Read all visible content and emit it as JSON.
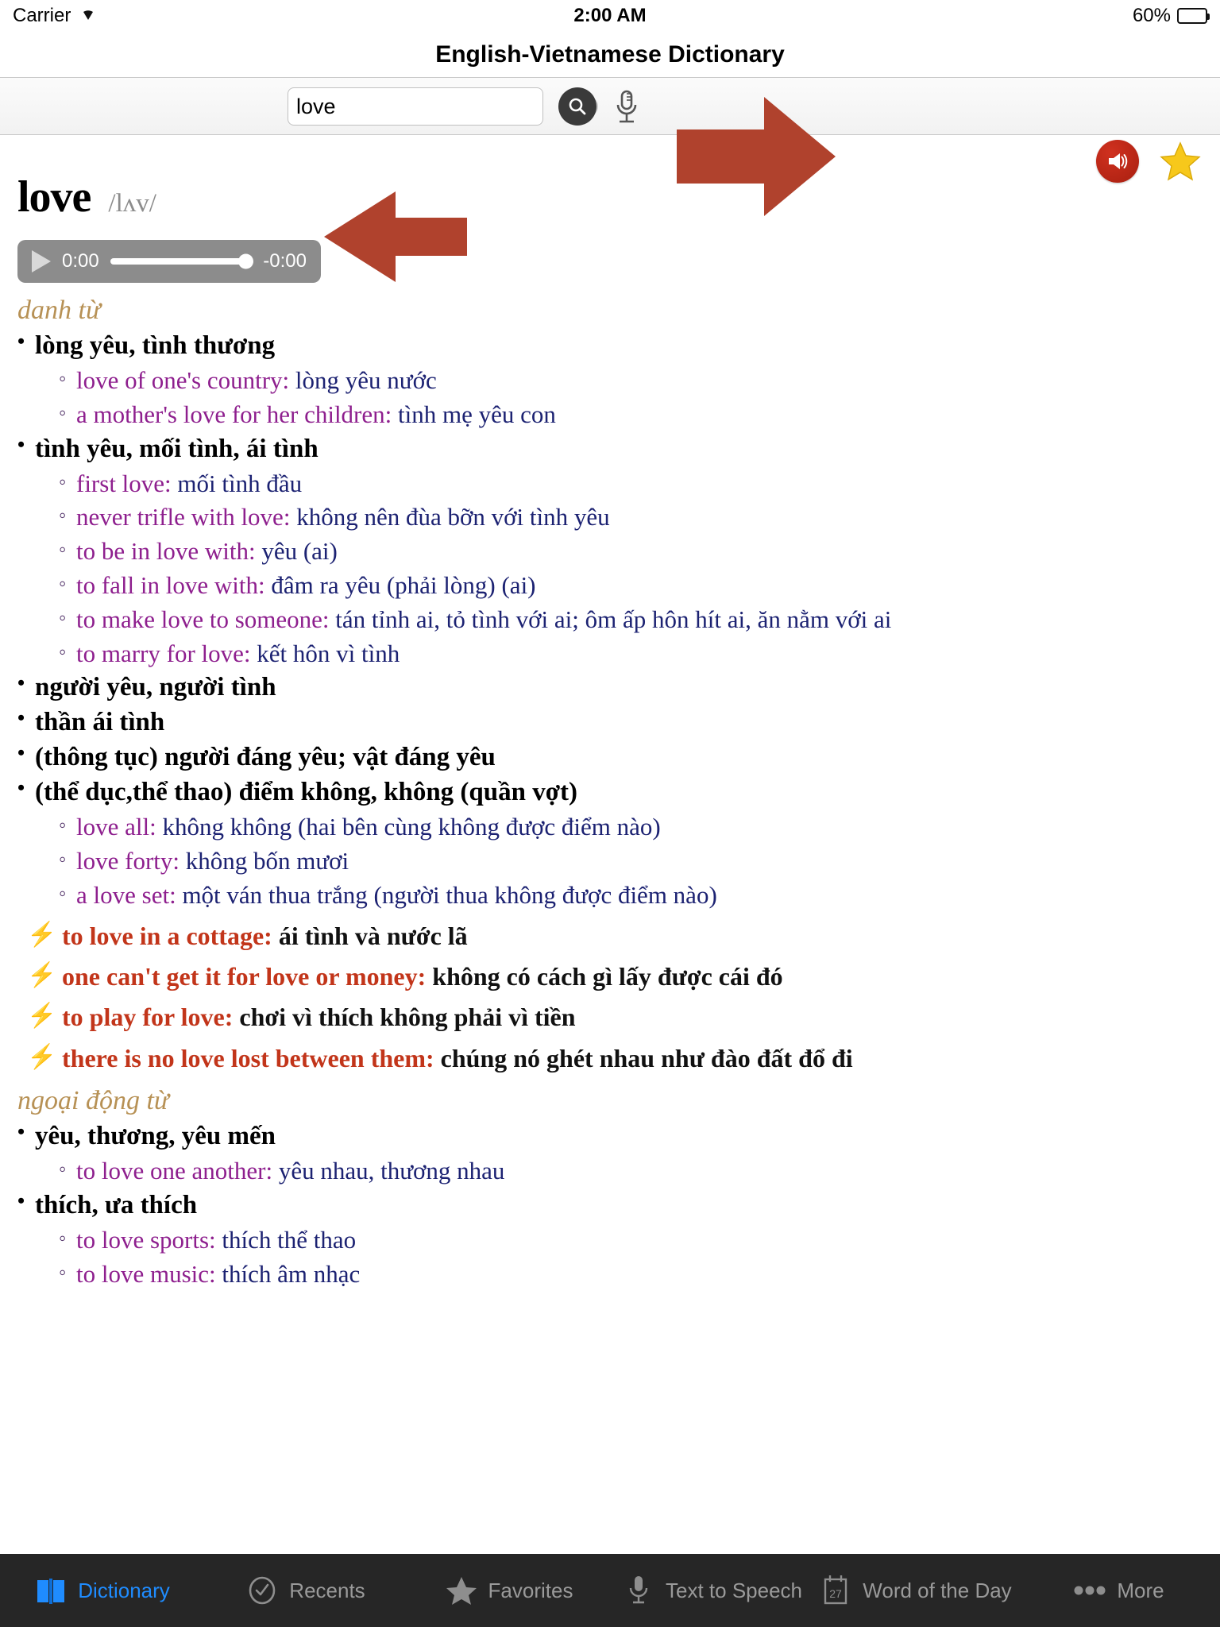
{
  "status_bar": {
    "carrier": "Carrier",
    "wifi_icon": "wifi-icon",
    "time": "2:00 AM",
    "battery_percent": "60%",
    "battery_icon": "battery-icon"
  },
  "nav": {
    "title": "English-Vietnamese Dictionary"
  },
  "search": {
    "value": "love",
    "placeholder": "",
    "clear_icon": "clear-icon",
    "search_icon": "search-icon",
    "mic_icon": "microphone-icon"
  },
  "actions": {
    "speaker_icon": "speaker-icon",
    "star_icon": "star-icon"
  },
  "entry": {
    "headword": "love",
    "phonetic": "/lʌv/",
    "audio": {
      "play_icon": "play-icon",
      "elapsed": "0:00",
      "remaining": "-0:00",
      "progress_percent": 100
    },
    "sections": [
      {
        "pos": "danh từ",
        "blocks": [
          {
            "type": "sense",
            "text": "lòng yêu, tình thương",
            "examples": [
              {
                "en": "love of one's country:",
                "vi": " lòng yêu nước"
              },
              {
                "en": "a mother's love for her children:",
                "vi": " tình mẹ yêu con"
              }
            ]
          },
          {
            "type": "sense",
            "text": "tình yêu, mối tình, ái tình",
            "examples": [
              {
                "en": "first love:",
                "vi": " mối tình đầu"
              },
              {
                "en": "never trifle with love:",
                "vi": " không nên đùa bỡn với tình yêu"
              },
              {
                "en": "to be in love with:",
                "vi": " yêu (ai)"
              },
              {
                "en": "to fall in love with:",
                "vi": " đâm ra yêu (phải lòng) (ai)"
              },
              {
                "en": "to make love to someone:",
                "vi": " tán tỉnh ai, tỏ tình với ai; ôm ấp hôn hít ai, ăn nằm với ai"
              },
              {
                "en": "to marry for love:",
                "vi": " kết hôn vì tình"
              }
            ]
          },
          {
            "type": "sense",
            "text": "người yêu, người tình",
            "examples": []
          },
          {
            "type": "sense",
            "text": "thần ái tình",
            "examples": []
          },
          {
            "type": "sense",
            "text": "(thông tục) người đáng yêu; vật đáng yêu",
            "examples": []
          },
          {
            "type": "sense",
            "text": "(thể dục,thể thao) điểm không, không (quần vợt)",
            "examples": [
              {
                "en": "love all:",
                "vi": " không không (hai bên cùng không được điểm nào)"
              },
              {
                "en": "love forty:",
                "vi": " không bốn mươi"
              },
              {
                "en": "a love set:",
                "vi": " một ván thua trắng (người thua không được điểm nào)"
              }
            ]
          },
          {
            "type": "idiom",
            "bolt": "⚡",
            "en": "to love in a cottage:",
            "vi": " ái tình và nước lã"
          },
          {
            "type": "idiom",
            "bolt": "⚡",
            "en": "one can't get it for love or money:",
            "vi": " không có cách gì lấy được cái đó"
          },
          {
            "type": "idiom",
            "bolt": "⚡",
            "en": "to play for love:",
            "vi": " chơi vì thích không phải vì tiền"
          },
          {
            "type": "idiom",
            "bolt": "⚡",
            "en": "there is no love lost between them:",
            "vi": " chúng nó ghét nhau như đào đất đổ đi"
          }
        ]
      },
      {
        "pos": "ngoại động từ",
        "blocks": [
          {
            "type": "sense",
            "text": "yêu, thương, yêu mến",
            "examples": [
              {
                "en": "to love one another:",
                "vi": " yêu nhau, thương nhau"
              }
            ]
          },
          {
            "type": "sense",
            "text": "thích, ưa thích",
            "examples": [
              {
                "en": "to love sports:",
                "vi": " thích thể thao"
              },
              {
                "en": "to love music:",
                "vi": " thích âm nhạc"
              }
            ]
          }
        ]
      }
    ]
  },
  "annotations": {
    "arrow_color": "#b0422d",
    "arrow_audio_player": "arrow-pointing-to-audio-player",
    "arrow_speaker": "arrow-pointing-to-speaker-button"
  },
  "tab_bar": {
    "items": [
      {
        "label": "Dictionary",
        "icon": "book-icon",
        "active": true
      },
      {
        "label": "Recents",
        "icon": "clock-check-icon",
        "active": false
      },
      {
        "label": "Favorites",
        "icon": "star-icon",
        "active": false
      },
      {
        "label": "Text to Speech",
        "icon": "microphone-icon",
        "active": false
      },
      {
        "label": "Word of the Day",
        "icon": "calendar-icon",
        "active": false,
        "badge": "27"
      },
      {
        "label": "More",
        "icon": "ellipsis-icon",
        "active": false
      }
    ]
  },
  "colors": {
    "accent_blue": "#1f8cff",
    "pos_gold": "#b79155",
    "example_en_purple": "#8e1f8e",
    "example_vi_navy": "#1c2272",
    "idiom_red": "#c2351a",
    "speaker_red": "#c0291a",
    "star_yellow": "#f5c71a"
  }
}
